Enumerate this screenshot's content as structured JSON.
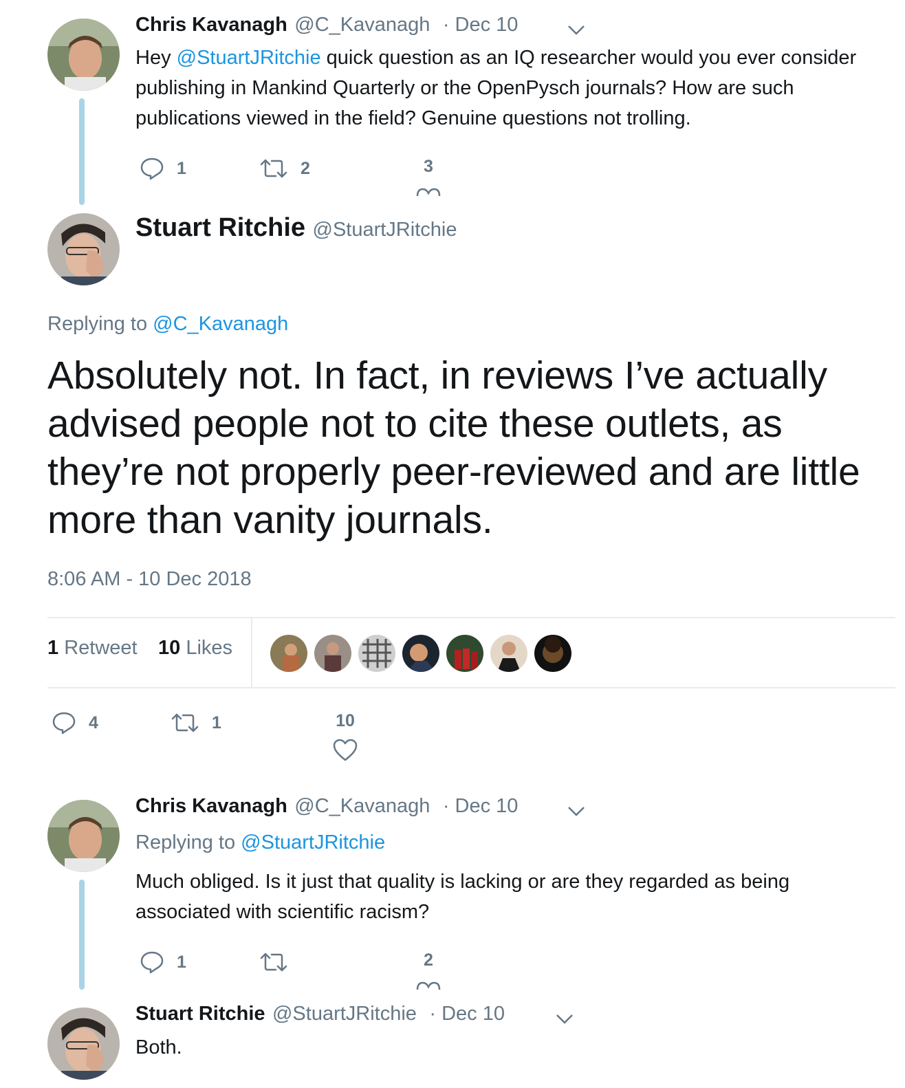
{
  "tweet1": {
    "name": "Chris Kavanagh",
    "handle": "@C_Kavanagh",
    "date": "· Dec 10",
    "text_before": "Hey ",
    "mention": "@StuartJRitchie",
    "text_after": " quick question as an IQ researcher would you ever consider publishing in Mankind Quarterly or the OpenPysch journals? How are such publications viewed in the field? Genuine questions not trolling.",
    "replies": "1",
    "retweets": "2",
    "likes": "3"
  },
  "main_tweet": {
    "name": "Stuart Ritchie",
    "handle": "@StuartJRitchie",
    "replying_label": "Replying to ",
    "replying_handle": "@C_Kavanagh",
    "text": "Absolutely not. In fact, in reviews I’ve actually advised people not to cite these outlets, as they’re not properly peer-reviewed and are little more than vanity journals.",
    "timestamp": "8:06 AM - 10 Dec 2018",
    "retweet_count": "1",
    "retweet_label": "Retweet",
    "likes_count": "10",
    "likes_label": "Likes",
    "replies": "4",
    "retweets": "1",
    "likes": "10"
  },
  "tweet3": {
    "name": "Chris Kavanagh",
    "handle": "@C_Kavanagh",
    "date": "· Dec 10",
    "replying_label": "Replying to ",
    "replying_handle": "@StuartJRitchie",
    "text": "Much obliged. Is it just that quality is lacking or are they regarded as being associated with scientific racism?",
    "replies": "1",
    "retweets": "",
    "likes": "2"
  },
  "tweet4": {
    "name": "Stuart Ritchie",
    "handle": "@StuartJRitchie",
    "date": "· Dec 10",
    "text": "Both."
  },
  "icons": {
    "reply": "reply-icon",
    "retweet": "retweet-icon",
    "like": "heart-icon",
    "caret": "chevron-down-icon"
  },
  "colors": {
    "link": "#1b95e0",
    "secondary": "#657786",
    "thread_line": "#a9d3e6"
  }
}
